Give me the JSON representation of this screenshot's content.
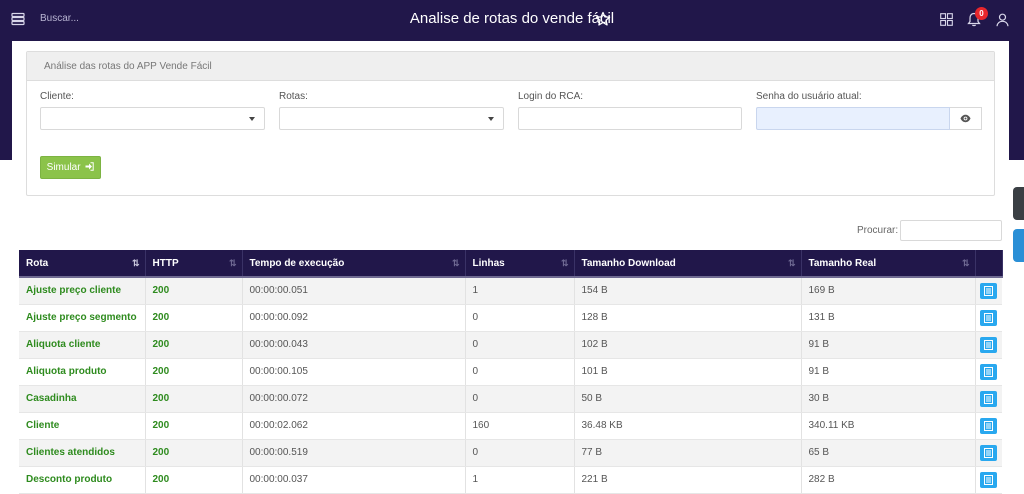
{
  "header": {
    "search_placeholder": "Buscar...",
    "title": "Analise de rotas do vende fácil",
    "notification_count": "0"
  },
  "panel": {
    "heading": "Análise das rotas do APP Vende Fácil",
    "fields": {
      "cliente_label": "Cliente:",
      "rotas_label": "Rotas:",
      "login_label": "Login do RCA:",
      "senha_label": "Senha do usuário atual:"
    },
    "simulate_label": "Simular"
  },
  "search": {
    "label": "Procurar:"
  },
  "table": {
    "columns": [
      "Rota",
      "HTTP",
      "Tempo de execução",
      "Linhas",
      "Tamanho Download",
      "Tamanho Real"
    ],
    "rows": [
      {
        "rota": "Ajuste preço cliente",
        "http": "200",
        "tempo": "00:00:00.051",
        "linhas": "1",
        "download": "154 B",
        "real": "169 B"
      },
      {
        "rota": "Ajuste preço segmento",
        "http": "200",
        "tempo": "00:00:00.092",
        "linhas": "0",
        "download": "128 B",
        "real": "131 B"
      },
      {
        "rota": "Aliquota cliente",
        "http": "200",
        "tempo": "00:00:00.043",
        "linhas": "0",
        "download": "102 B",
        "real": "91 B"
      },
      {
        "rota": "Aliquota produto",
        "http": "200",
        "tempo": "00:00:00.105",
        "linhas": "0",
        "download": "101 B",
        "real": "91 B"
      },
      {
        "rota": "Casadinha",
        "http": "200",
        "tempo": "00:00:00.072",
        "linhas": "0",
        "download": "50 B",
        "real": "30 B"
      },
      {
        "rota": "Cliente",
        "http": "200",
        "tempo": "00:00:02.062",
        "linhas": "160",
        "download": "36.48 KB",
        "real": "340.11 KB"
      },
      {
        "rota": "Clientes atendidos",
        "http": "200",
        "tempo": "00:00:00.519",
        "linhas": "0",
        "download": "77 B",
        "real": "65 B"
      },
      {
        "rota": "Desconto produto",
        "http": "200",
        "tempo": "00:00:00.037",
        "linhas": "1",
        "download": "221 B",
        "real": "282 B"
      }
    ]
  },
  "colors": {
    "navy": "#21174a",
    "green_button": "#8bc34a",
    "route_green": "#2e8b1e",
    "action_blue": "#29a8ef",
    "badge_red": "#e8262c"
  },
  "icons": [
    "menu-icon",
    "star-icon",
    "grid-icon",
    "bell-icon",
    "user-icon",
    "eye-icon",
    "sign-in-icon",
    "list-icon",
    "sort-icon"
  ]
}
